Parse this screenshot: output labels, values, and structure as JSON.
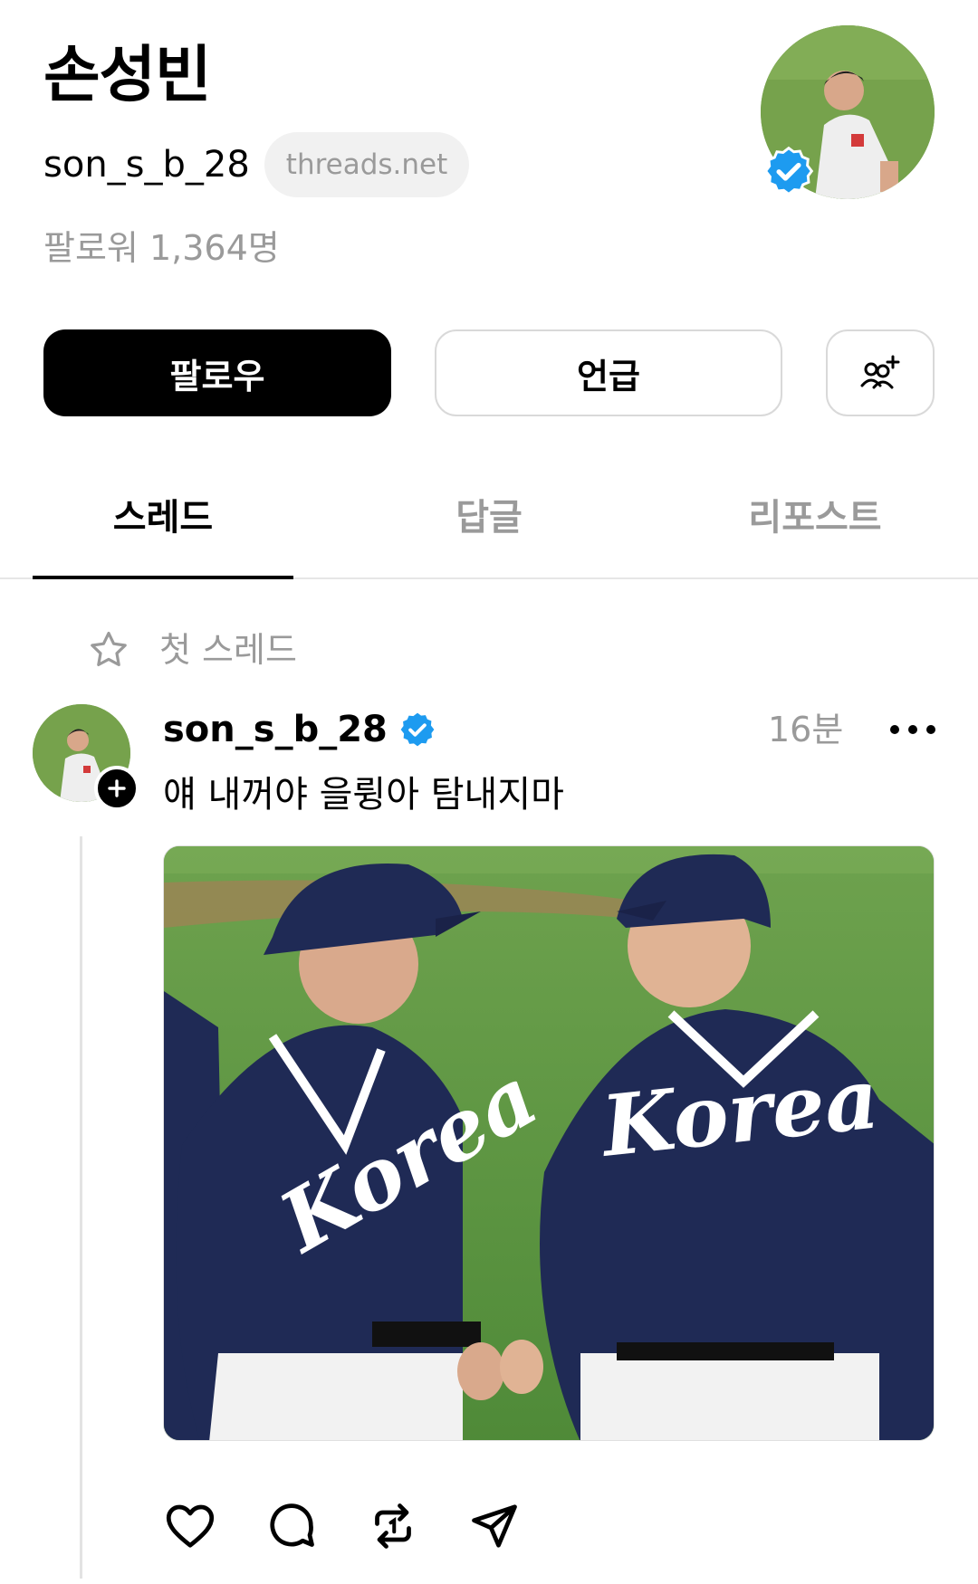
{
  "profile": {
    "display_name": "손성빈",
    "handle": "son_s_b_28",
    "domain": "threads.net",
    "followers": "팔로워 1,364명"
  },
  "buttons": {
    "follow": "팔로우",
    "mention": "언급"
  },
  "tabs": [
    {
      "label": "스레드",
      "active": true
    },
    {
      "label": "답글",
      "active": false
    },
    {
      "label": "리포스트",
      "active": false
    }
  ],
  "feed": {
    "pinned_label": "첫 스레드",
    "post": {
      "username": "son_s_b_28",
      "time": "16분",
      "text": "얘 내꺼야 을륑아 탐내지마",
      "image_jersey_text_left": "Korea",
      "image_jersey_text_right": "Korea"
    }
  },
  "colors": {
    "verified_blue": "#1d9bf0",
    "muted_text": "#9a9a9a",
    "jersey_navy": "#1f2a55"
  },
  "icons": [
    "verified-badge-icon",
    "add-friend-icon",
    "star-icon",
    "plus-icon",
    "more-icon",
    "heart-icon",
    "comment-icon",
    "repost-icon",
    "share-icon"
  ]
}
